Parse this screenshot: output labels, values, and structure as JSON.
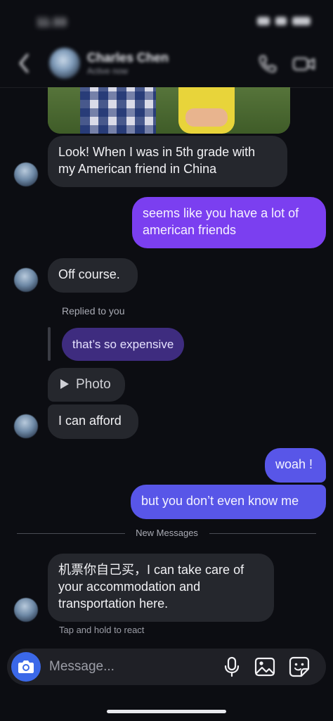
{
  "status": {
    "time": "11:33"
  },
  "header": {
    "contact_name": "Charles Chen",
    "contact_subtitle": "Active now",
    "back_icon": "chevron-left-icon",
    "call_icon": "phone-icon",
    "video_icon": "video-camera-icon"
  },
  "messages": [
    {
      "from": "them",
      "text": "Look! When I was in 5th grade with\nmy American friend in China"
    },
    {
      "from": "me",
      "text": "seems like you have a lot of\namerican friends"
    },
    {
      "from": "them",
      "text": "Off course."
    },
    {
      "from": "them",
      "text": "I can afford"
    },
    {
      "from": "me",
      "text": "woah !"
    },
    {
      "from": "me",
      "text": "but you don’t even know me"
    },
    {
      "from": "them",
      "text": "机票你自己买，I can take care of\nyour accommodation and\ntransportation here."
    }
  ],
  "reply": {
    "label": "Replied to you",
    "quoted_text": "that’s so expensive"
  },
  "photo_chip": {
    "label": "Photo"
  },
  "divider": {
    "label": "New Messages"
  },
  "hint": {
    "text": "Tap and hold to react"
  },
  "composer": {
    "placeholder": "Message...",
    "value": "",
    "camera_icon": "camera-icon",
    "mic_icon": "microphone-icon",
    "gallery_icon": "image-icon",
    "sticker_icon": "sticker-icon"
  },
  "colors": {
    "background": "#0c0d12",
    "incoming_bubble": "#25272d",
    "outgoing_purple": "#7b3ff0",
    "outgoing_blue": "#5856e8",
    "reply_bubble": "#3e2c7f",
    "camera_button": "#3b68e8"
  }
}
